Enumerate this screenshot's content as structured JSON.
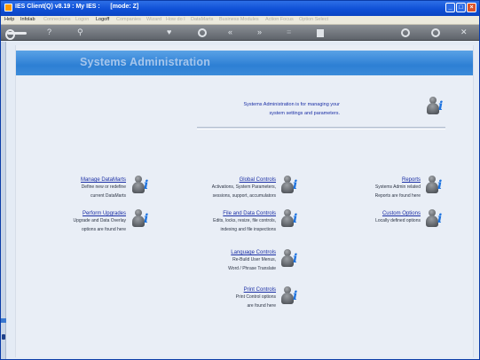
{
  "window": {
    "title": "IES Client(Q) v8.19 : My IES :      [mode: Z]",
    "controls": {
      "minimize": "_",
      "maximize": "□",
      "close": "×"
    }
  },
  "menu": {
    "items": [
      {
        "label": "Help",
        "enabled": true
      },
      {
        "label": "Infolab",
        "enabled": true
      },
      {
        "label": "Connections",
        "enabled": false
      },
      {
        "label": "Logon",
        "enabled": false
      },
      {
        "label": "Logoff",
        "enabled": true
      },
      {
        "label": "Companies",
        "enabled": false
      },
      {
        "label": "Wizard",
        "enabled": false
      },
      {
        "label": "How do I",
        "enabled": false
      },
      {
        "label": "DataMarts",
        "enabled": false
      },
      {
        "label": "Business Modules",
        "enabled": false
      },
      {
        "label": "Action Focus",
        "enabled": false
      },
      {
        "label": "Option Select",
        "enabled": false
      }
    ]
  },
  "toolbar": {
    "help": "?",
    "search": "⚲",
    "heart": "♥",
    "back": "«",
    "forward": "»",
    "plus": "+",
    "check": "✓",
    "close": "✕"
  },
  "page": {
    "title": "Systems Administration",
    "intro_line1": "Systems Administration is for managing your",
    "intro_line2": "system settings and parameters.",
    "icon_glyph": "i",
    "items": {
      "manage_datamarts": {
        "link": "Manage DataMarts",
        "desc1": "Define new or redefine",
        "desc2": "current DataMarts"
      },
      "global_controls": {
        "link": "Global Controls",
        "desc1": "Activations, System Parameters,",
        "desc2": "sessions, support, accumulators"
      },
      "reports": {
        "link": "Reports",
        "desc1": "Systems Admin related",
        "desc2": "Reports are found here"
      },
      "perform_upgrades": {
        "link": "Perform Upgrades",
        "desc1": "Upgrade and Data Overlay",
        "desc2": "options are found here"
      },
      "file_data_controls": {
        "link": "File and Data Controls",
        "desc1": "Edits, locks, resize, file controls,",
        "desc2": "indexing and file inspections"
      },
      "custom_options": {
        "link": "Custom Options",
        "desc1": "Locally defined options"
      },
      "language_controls": {
        "link": "Language Controls",
        "desc1": "Re-Build User Menus,",
        "desc2": "Word / Phrase Translate"
      },
      "print_controls": {
        "link": "Print Controls",
        "desc1": "Print Control options",
        "desc2": "are found here"
      }
    }
  }
}
